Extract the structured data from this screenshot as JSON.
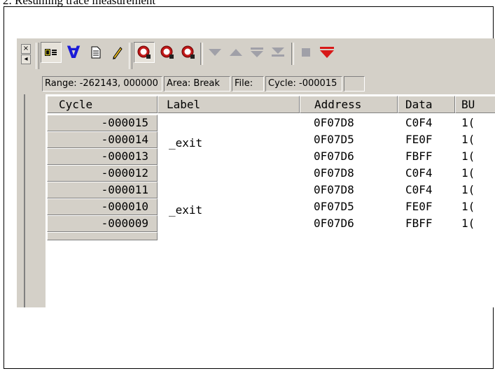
{
  "doc": {
    "heading": "2. Resuming trace measurement"
  },
  "toolbar": {
    "side_close": "×",
    "side_arrow": "◂",
    "icons": [
      "memory-dump-icon",
      "filter-icon",
      "document-icon",
      "edit-pencil-icon",
      "search-trace-icon",
      "search-trace-2-icon",
      "search-trace-3-icon",
      "down-arrow-icon",
      "up-arrow-icon",
      "down-step-icon",
      "bottom-arrow-icon",
      "stop-icon",
      "resume-trace-icon"
    ],
    "colors": {
      "accent_red": "#d81818",
      "accent_blue": "#1a1ad8",
      "disabled": "#a0a0a8"
    }
  },
  "status": {
    "range": "Range: -262143,  000000",
    "area": "Area: Break",
    "file": "File:",
    "cycle": "Cycle: -000015"
  },
  "grid": {
    "headers": [
      "Cycle",
      "Label",
      "Address",
      "Data",
      "BU"
    ],
    "rows": [
      {
        "cycle": "-000015",
        "label": "",
        "address": "0F07D8",
        "data": "C0F4",
        "bu": "1("
      },
      {
        "cycle": "-000014",
        "label": "_exit",
        "address": "0F07D5",
        "data": "FE0F",
        "bu": "1("
      },
      {
        "cycle": "-000013",
        "label": "",
        "address": "0F07D6",
        "data": "FBFF",
        "bu": "1("
      },
      {
        "cycle": "-000012",
        "label": "",
        "address": "0F07D8",
        "data": "C0F4",
        "bu": "1("
      },
      {
        "cycle": "-000011",
        "label": "",
        "address": "0F07D8",
        "data": "C0F4",
        "bu": "1("
      },
      {
        "cycle": "-000010",
        "label": "_exit",
        "address": "0F07D5",
        "data": "FE0F",
        "bu": "1("
      },
      {
        "cycle": "-000009",
        "label": "",
        "address": "0F07D6",
        "data": "FBFF",
        "bu": "1("
      }
    ]
  }
}
